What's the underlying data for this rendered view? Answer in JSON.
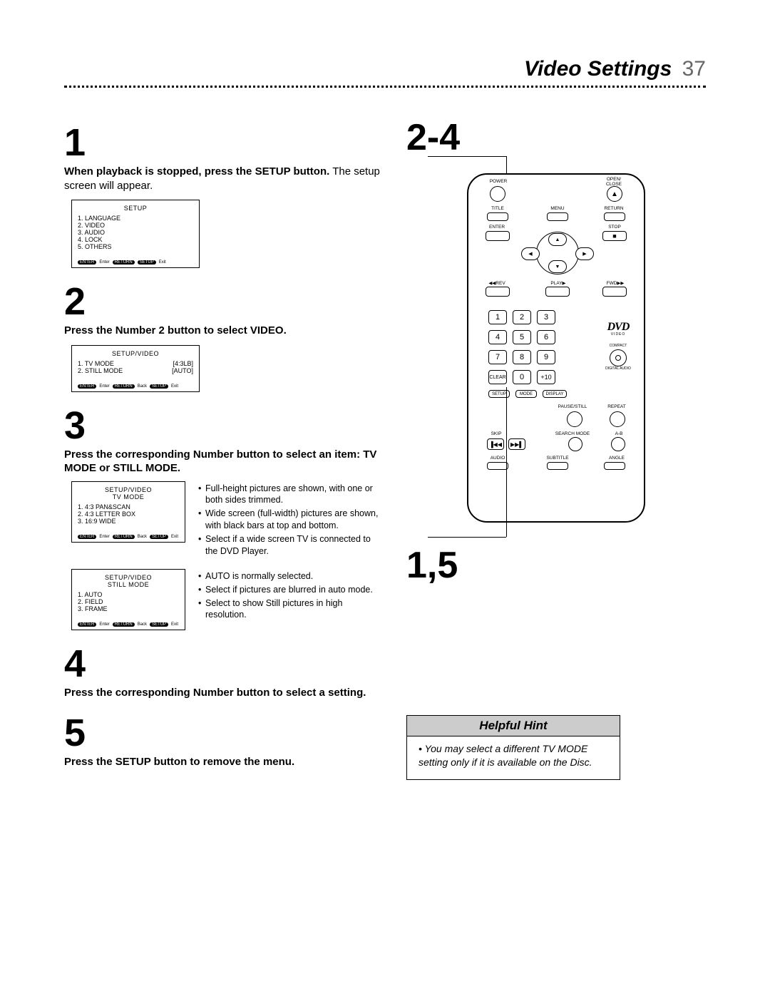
{
  "header": {
    "title": "Video Settings",
    "page": "37"
  },
  "steps": {
    "s1": {
      "num": "1",
      "bold": "When playback is stopped, press the SETUP button.",
      "rest": " The setup screen will appear."
    },
    "s2": {
      "num": "2",
      "bold": "Press the Number 2 button to select VIDEO."
    },
    "s3": {
      "num": "3",
      "bold": "Press the corresponding Number button to select an item: TV MODE or STILL MODE."
    },
    "s4": {
      "num": "4",
      "bold": "Press the corresponding Number button to select a setting."
    },
    "s5": {
      "num": "5",
      "bold": "Press the SETUP button to remove the menu."
    }
  },
  "osd1": {
    "title": "SETUP",
    "items": [
      "1. LANGUAGE",
      "2. VIDEO",
      "3. AUDIO",
      "4. LOCK",
      "5. OTHERS"
    ],
    "footer": {
      "p1": "ENTER",
      "t1": "Enter",
      "p2": "RETURN",
      "p3": "SETUP",
      "t2": "Exit"
    }
  },
  "osd2": {
    "title": "SETUP/VIDEO",
    "rows": [
      {
        "l": "1. TV MODE",
        "r": "[4:3LB]"
      },
      {
        "l": "2. STILL MODE",
        "r": "[AUTO]"
      }
    ],
    "footer": {
      "p1": "ENTER",
      "t1": "Enter",
      "p2": "RETURN",
      "t2": "Back",
      "p3": "SETUP",
      "t3": "Exit"
    }
  },
  "osd3a": {
    "title": "SETUP/VIDEO",
    "sub": "TV MODE",
    "items": [
      "1. 4:3 PAN&SCAN",
      "2. 4:3 LETTER BOX",
      "3. 16:9 WIDE"
    ],
    "footer": {
      "p1": "ENTER",
      "t1": "Enter",
      "p2": "RETURN",
      "t2": "Back",
      "p3": "SETUP",
      "t3": "Exit"
    }
  },
  "osd3a_bullets": [
    "Full-height pictures are shown, with one or both sides trimmed.",
    "Wide screen (full-width) pictures are shown, with black bars at top and bottom.",
    "Select if a wide screen TV is connected to the DVD Player."
  ],
  "osd3b": {
    "title": "SETUP/VIDEO",
    "sub": "STILL MODE",
    "items": [
      "1. AUTO",
      "2. FIELD",
      "3. FRAME"
    ],
    "footer": {
      "p1": "ENTER",
      "t1": "Enter",
      "p2": "RETURN",
      "t2": "Back",
      "p3": "SETUP",
      "t3": "Exit"
    }
  },
  "osd3b_bullets": [
    "AUTO is normally selected.",
    "Select if pictures are blurred in auto mode.",
    "Select to show Still pictures in high resolution."
  ],
  "callouts": {
    "top": "2-4",
    "bottom": "1,5"
  },
  "remote": {
    "labels": {
      "power": "POWER",
      "open": "OPEN/\nCLOSE",
      "title": "TITLE",
      "menu": "MENU",
      "return": "RETURN",
      "enter": "ENTER",
      "stop": "STOP",
      "rev": "◀◀REV",
      "play": "PLAY▶",
      "fwd": "FWD▶▶",
      "clear": "CLEAR",
      "plus10": "+10",
      "setup": "SETUP",
      "mode": "MODE",
      "display": "DISPLAY",
      "pausestill": "PAUSE/STILL",
      "repeat": "REPEAT",
      "skip": "SKIP",
      "searchmode": "SEARCH MODE",
      "ab": "A-B",
      "audio": "AUDIO",
      "subtitle": "SUBTITLE",
      "angle": "ANGLE"
    },
    "nums": [
      "1",
      "2",
      "3",
      "4",
      "5",
      "6",
      "7",
      "8",
      "9",
      "0"
    ],
    "dvd": "DVD",
    "video": "VIDEO",
    "cd_top": "COMPACT",
    "cd_bot": "DIGITAL AUDIO"
  },
  "hint": {
    "title": "Helpful Hint",
    "body": "You may select a different TV MODE setting only if it is available on the Disc."
  }
}
